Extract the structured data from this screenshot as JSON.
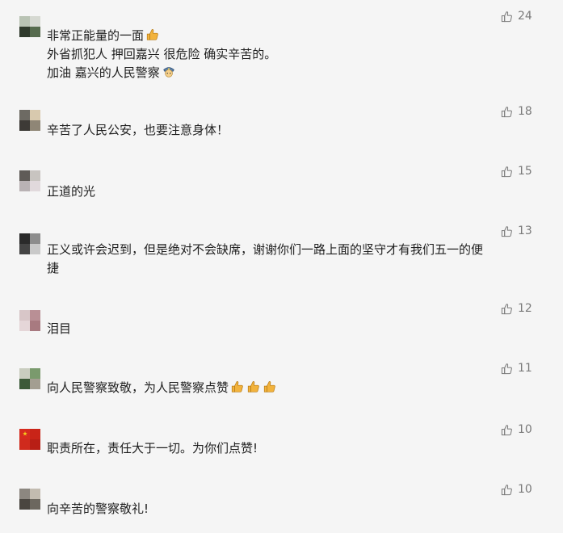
{
  "like_icon": "thumbs-up-outline-icon",
  "colors": {
    "background": "#f5f5f5",
    "text": "#1e1e1e",
    "count": "#7a7a7a",
    "thumb_emoji": "#f2b33d"
  },
  "comments": [
    {
      "username": "",
      "lines": [
        "非常正能量的一面",
        "外省抓犯人 押回嘉兴 很危险 确实辛苦的。",
        "加油 嘉兴的人民警察"
      ],
      "emoji_after_line_1": "thumbs-up-emoji",
      "emoji_after_line_3": "police-officer-emoji",
      "likes": "24"
    },
    {
      "username": "",
      "lines": [
        "辛苦了人民公安，也要注意身体！"
      ],
      "likes": "18"
    },
    {
      "username": "",
      "lines": [
        "正道的光"
      ],
      "likes": "15"
    },
    {
      "username": "",
      "lines": [
        "正义或许会迟到，但是绝对不会缺席，谢谢你们一路上面的坚守才有我们五一的便",
        "捷"
      ],
      "likes": "13"
    },
    {
      "username": "",
      "lines": [
        "泪目"
      ],
      "likes": "12"
    },
    {
      "username": "",
      "lines": [
        "向人民警察致敬，为人民警察点赞"
      ],
      "emoji_trailing": [
        "thumbs-up-emoji",
        "thumbs-up-emoji",
        "thumbs-up-emoji"
      ],
      "likes": "11"
    },
    {
      "username": "",
      "lines": [
        "职责所在，责任大于一切。为你们点赞!"
      ],
      "likes": "10"
    },
    {
      "username": "",
      "lines": [
        "向辛苦的警察敬礼!"
      ],
      "likes": "10"
    }
  ]
}
